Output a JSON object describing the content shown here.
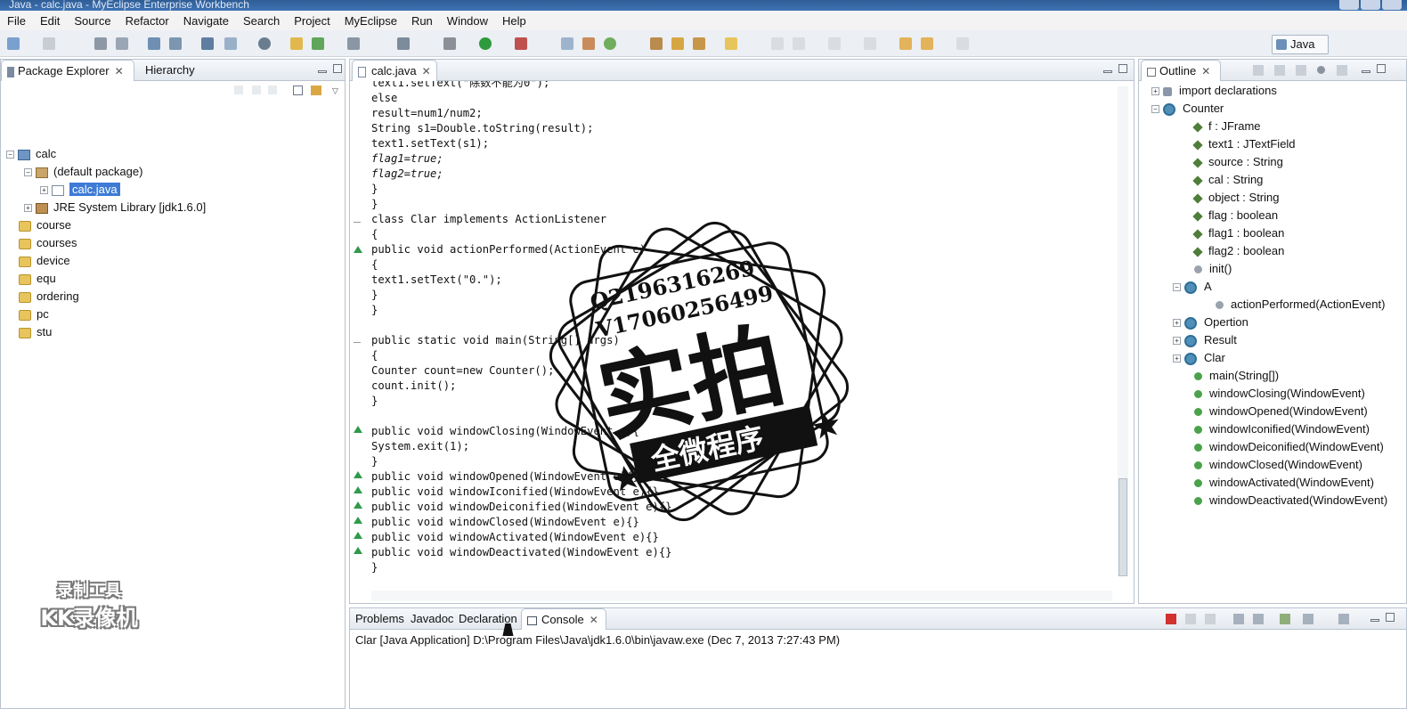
{
  "window": {
    "title": "Java - calc.java - MyEclipse Enterprise Workbench"
  },
  "menu": [
    "File",
    "Edit",
    "Source",
    "Refactor",
    "Navigate",
    "Search",
    "Project",
    "MyEclipse",
    "Run",
    "Window",
    "Help"
  ],
  "toolbar": {
    "perspective_label": "Java"
  },
  "package_explorer": {
    "tabs": {
      "explorer": "Package Explorer",
      "hierarchy": "Hierarchy"
    },
    "tree": [
      {
        "label": "calc",
        "icon": "project-icon"
      },
      {
        "label": "(default package)",
        "icon": "package-icon"
      },
      {
        "label": "calc.java",
        "icon": "java-file-icon",
        "selected": true
      },
      {
        "label": "JRE System Library [jdk1.6.0]",
        "icon": "library-icon"
      },
      {
        "label": "course",
        "icon": "folder-icon"
      },
      {
        "label": "courses",
        "icon": "folder-icon"
      },
      {
        "label": "device",
        "icon": "folder-icon"
      },
      {
        "label": "equ",
        "icon": "folder-icon"
      },
      {
        "label": "ordering",
        "icon": "folder-icon"
      },
      {
        "label": "pc",
        "icon": "folder-icon"
      },
      {
        "label": "stu",
        "icon": "folder-icon"
      }
    ]
  },
  "editor": {
    "tab": "calc.java",
    "lines": [
      "text1.setText(\"除数不能为0\");",
      "else",
      "result=num1/num2;",
      "String s1=Double.toString(result);",
      "text1.setText(s1);",
      "flag1=true;",
      "flag2=true;",
      "}",
      "}",
      "class Clar implements ActionListener",
      "{",
      "public void actionPerformed(ActionEvent e)",
      "{",
      "text1.setText(\"0.\");",
      "}",
      "}",
      "",
      "public static void main(String[] args)",
      "{",
      "Counter count=new Counter();",
      "count.init();",
      "}",
      "",
      "public void windowClosing(WindowEvent e){",
      "System.exit(1);",
      "}",
      "public void windowOpened(WindowEvent e){}",
      "public void windowIconified(WindowEvent e){}",
      "public void windowDeiconified(WindowEvent e){}",
      "public void windowClosed(WindowEvent e){}",
      "public void windowActivated(WindowEvent e){}",
      "public void windowDeactivated(WindowEvent e){}",
      "}"
    ]
  },
  "outline": {
    "tab": "Outline",
    "items": [
      {
        "label": "import declarations",
        "icon": "import-icon"
      },
      {
        "label": "Counter",
        "icon": "class-icon"
      },
      {
        "label": "f : JFrame",
        "icon": "field-icon"
      },
      {
        "label": "text1 : JTextField",
        "icon": "field-icon"
      },
      {
        "label": "source : String",
        "icon": "field-icon"
      },
      {
        "label": "cal : String",
        "icon": "field-icon"
      },
      {
        "label": "object : String",
        "icon": "field-icon"
      },
      {
        "label": "flag : boolean",
        "icon": "field-icon"
      },
      {
        "label": "flag1 : boolean",
        "icon": "field-icon"
      },
      {
        "label": "flag2 : boolean",
        "icon": "field-icon"
      },
      {
        "label": "init()",
        "icon": "method-icon"
      },
      {
        "label": "A",
        "icon": "class-icon"
      },
      {
        "label": "actionPerformed(ActionEvent)",
        "icon": "method-icon"
      },
      {
        "label": "Opertion",
        "icon": "class-icon"
      },
      {
        "label": "Result",
        "icon": "class-icon"
      },
      {
        "label": "Clar",
        "icon": "class-icon"
      },
      {
        "label": "main(String[])",
        "icon": "method-icon"
      },
      {
        "label": "windowClosing(WindowEvent)",
        "icon": "method-icon"
      },
      {
        "label": "windowOpened(WindowEvent)",
        "icon": "method-icon"
      },
      {
        "label": "windowIconified(WindowEvent)",
        "icon": "method-icon"
      },
      {
        "label": "windowDeiconified(WindowEvent)",
        "icon": "method-icon"
      },
      {
        "label": "windowClosed(WindowEvent)",
        "icon": "method-icon"
      },
      {
        "label": "windowActivated(WindowEvent)",
        "icon": "method-icon"
      },
      {
        "label": "windowDeactivated(WindowEvent)",
        "icon": "method-icon"
      }
    ]
  },
  "bottom": {
    "tabs": [
      "Problems",
      "Javadoc",
      "Declaration",
      "Console"
    ],
    "console_header": "Clar [Java Application] D:\\Program Files\\Java\\jdk1.6.0\\bin\\javaw.exe (Dec 7, 2013 7:27:43 PM)"
  },
  "watermark": {
    "line1": "Q2196316269",
    "line2": "V17060256499",
    "big": "实拍",
    "banner": "全微程序"
  },
  "recorder_badge": {
    "line1": "录制工具",
    "line2": "KK录像机"
  },
  "colors": {
    "selection": "#3d7bd6",
    "title_bar": "#3d73b4",
    "override_marker": "#2f9a4c"
  }
}
